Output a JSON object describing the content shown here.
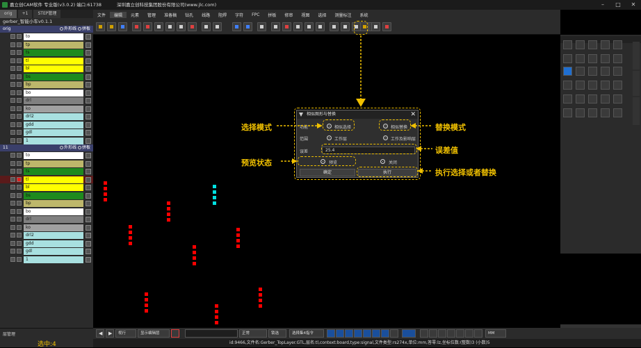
{
  "titlebar": {
    "app": "嘉立创CAM软件 专业版(v3.0.2) 端口:61738",
    "company": "深圳嘉立创科技集团股份有限公司(www.jlc.com)"
  },
  "left": {
    "tabs": [
      "orig",
      "+1",
      "STEP管理"
    ],
    "project": "gerber_智能小车v0.1.1",
    "groups": [
      {
        "name": "orig",
        "opt1": "外形线",
        "opt2": "拼板",
        "layers": [
          {
            "name": "to",
            "color": "#ffffff"
          },
          {
            "name": "tp",
            "color": "#bdb76b"
          },
          {
            "name": "ts",
            "color": "#1e8a1e"
          },
          {
            "name": "tl",
            "color": "#ffff00"
          },
          {
            "name": "bl",
            "color": "#ffff00"
          },
          {
            "name": "bs",
            "color": "#1e8a1e"
          },
          {
            "name": "bp",
            "color": "#bdb76b"
          },
          {
            "name": "bo",
            "color": "#ffffff"
          },
          {
            "name": "drl",
            "color": "#808080"
          },
          {
            "name": "ko",
            "color": "#a0a0a0"
          },
          {
            "name": "drl2",
            "color": "#a8e0e0"
          },
          {
            "name": "gdd",
            "color": "#a8e0e0"
          },
          {
            "name": "gdl",
            "color": "#a8e0e0"
          },
          {
            "name": "1",
            "color": "#a8e0e0"
          }
        ]
      },
      {
        "name": "11",
        "opt1": "外形线",
        "opt2": "拼板",
        "layers": [
          {
            "name": "to",
            "color": "#ffffff"
          },
          {
            "name": "tp",
            "color": "#bdb76b"
          },
          {
            "name": "ts",
            "color": "#1e8a1e"
          },
          {
            "name": "tl",
            "color": "#ffff00"
          },
          {
            "name": "bl",
            "color": "#ffff00"
          },
          {
            "name": "bs",
            "color": "#1e8a1e"
          },
          {
            "name": "bp",
            "color": "#bdb76b"
          },
          {
            "name": "bo",
            "color": "#ffffff"
          },
          {
            "name": "drl",
            "color": "#808080"
          },
          {
            "name": "ko",
            "color": "#a0a0a0"
          },
          {
            "name": "drl2",
            "color": "#a8e0e0"
          },
          {
            "name": "gdd",
            "color": "#a8e0e0"
          },
          {
            "name": "gdl",
            "color": "#a8e0e0"
          },
          {
            "name": "1",
            "color": "#a8e0e0"
          }
        ]
      }
    ],
    "layer_mgr": "层管理",
    "selected": "选中:4"
  },
  "menu": [
    "文件",
    "编辑",
    "元素",
    "管理",
    "准备稿",
    "钻孔",
    "线路",
    "阻焊",
    "字符",
    "FPC",
    "拼板",
    "修审",
    "视图",
    "选择",
    "测量标注",
    "系统"
  ],
  "dialog": {
    "title": "相似图形与替换",
    "mode_label": "功能",
    "mode_opt1": "相似选择",
    "mode_opt2": "相似替换",
    "scope_label": "范围",
    "scope_opt1": "工作层",
    "scope_opt2": "工作及影响层",
    "tol_label": "误差",
    "tolerance": "25.4",
    "preview_label": "预览",
    "close_label": "关闭",
    "ok_label": "确定",
    "exec_label": "执行"
  },
  "annotations": {
    "select_mode": "选择模式",
    "replace_mode": "替换模式",
    "tolerance": "误差值",
    "preview": "预览状态",
    "execute": "执行选择或者替换"
  },
  "bottom": {
    "view": "视行",
    "display": "显示编辑层",
    "unit_mode": "正常",
    "lock": "锁选",
    "filter": "选择集4指令",
    "unit": "MM"
  },
  "status": "id:9466,文件名:Gerber_TopLayer.GTL,层名:tl,context:board,type:signal,文件类型:rs274x,单位:mm,答零:lz,坐标位数:(整数)3 (小数)5",
  "colors": {
    "accent": "#f0c000",
    "pad_red": "#ff0000",
    "pad_cyan": "#00e0e0"
  }
}
